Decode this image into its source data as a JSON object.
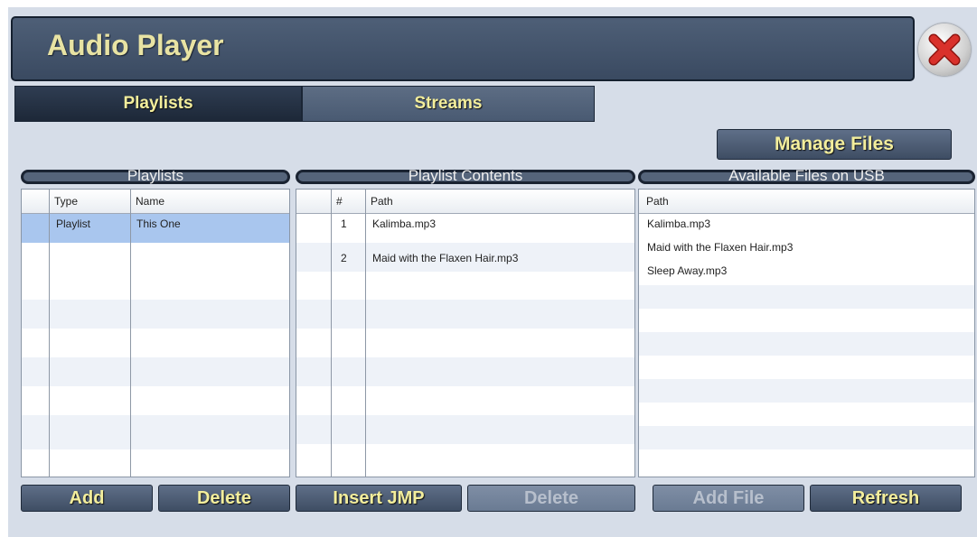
{
  "window": {
    "title": "Audio Player"
  },
  "tabs": [
    {
      "label": "Playlists",
      "active": true
    },
    {
      "label": "Streams",
      "active": false
    }
  ],
  "manage_files_label": "Manage Files",
  "playlists": {
    "header": "Playlists",
    "columns": [
      "Type",
      "Name"
    ],
    "rows": [
      {
        "type": "Playlist",
        "name": "This One",
        "selected": true
      }
    ],
    "buttons": {
      "add": "Add",
      "delete": "Delete"
    }
  },
  "playlist_contents": {
    "header": "Playlist Contents",
    "columns": [
      "#",
      "Path"
    ],
    "rows": [
      {
        "num": "1",
        "path": "Kalimba.mp3"
      },
      {
        "num": "2",
        "path": "Maid with the Flaxen Hair.mp3"
      }
    ],
    "buttons": {
      "insert_jmp": "Insert JMP",
      "delete": "Delete"
    }
  },
  "usb_files": {
    "header": "Available Files on USB",
    "columns": [
      "Path"
    ],
    "rows": [
      "Kalimba.mp3",
      "Maid with the Flaxen Hair.mp3",
      "Sleep Away.mp3"
    ],
    "buttons": {
      "add_file": "Add File",
      "refresh": "Refresh"
    }
  },
  "colors": {
    "title_text": "#e8e3a3",
    "button_text": "#f3ee9c",
    "selected_row": "#a9c6ee",
    "close_icon": "#d9312b"
  },
  "icons": {
    "close": "close-icon"
  }
}
